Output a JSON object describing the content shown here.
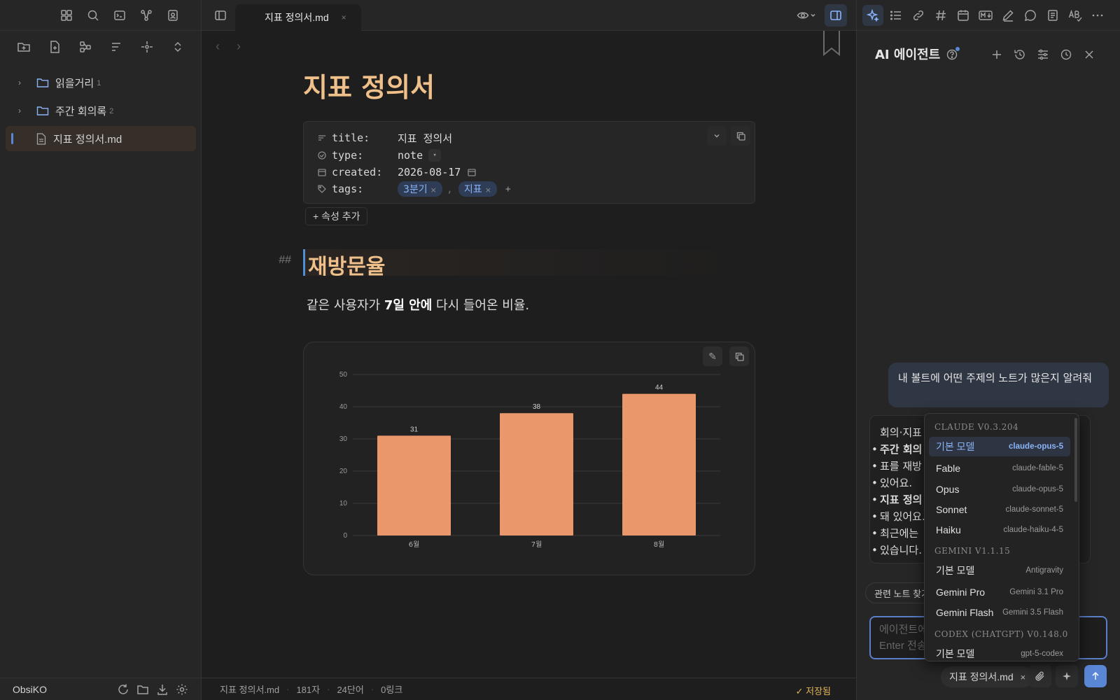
{
  "left_sidebar": {
    "tree": [
      {
        "label": "읽을거리",
        "count": "1",
        "type": "folder"
      },
      {
        "label": "주간 회의록",
        "count": "2",
        "type": "folder"
      },
      {
        "label": "지표 정의서.md",
        "count": "",
        "type": "file",
        "active": true
      }
    ],
    "vault_name": "ObsiKO"
  },
  "tab": {
    "title": "지표 정의서.md",
    "close": "×"
  },
  "note": {
    "title": "지표 정의서",
    "properties": {
      "title_key": "title:",
      "title_val": "지표 정의서",
      "type_key": "type:",
      "type_val": "note",
      "created_key": "created:",
      "created_val": "2026-08-17",
      "tags_key": "tags:",
      "tags": [
        "3분기",
        "지표"
      ]
    },
    "add_property": "+ 속성 추가",
    "heading_marker": "##",
    "heading": "재방문율",
    "para_pre": "같은 사용자가 ",
    "para_bold": "7일 안에",
    "para_post": " 다시 들어온 비율."
  },
  "chart_data": {
    "type": "bar",
    "categories": [
      "6월",
      "7월",
      "8월"
    ],
    "values": [
      31,
      38,
      44
    ],
    "ylim": [
      0,
      50
    ],
    "yticks": [
      0,
      10,
      20,
      30,
      40,
      50
    ],
    "bar_color": "#e9976b",
    "grid": true,
    "title": "",
    "xlabel": "",
    "ylabel": ""
  },
  "status_bar": {
    "file": "지표 정의서.md",
    "chars": "181자",
    "words": "24단어",
    "links": "0링크",
    "saved": "✓ 저장됨"
  },
  "agent": {
    "title": "AI 에이전트",
    "user_message": "내 볼트에 어떤 주제의 노트가 많은지 알려줘",
    "ai_line1": "회의·지표",
    "ai_b1": "주간 회의",
    "ai_b1_rest1": "표를 재방",
    "ai_b1_rest2": "있어요.",
    "ai_b2": "지표 정의",
    "ai_b2_rest1": "돼 있어요.",
    "ai_b2_rest2": "최근에는",
    "ai_b2_rest3": "있습니다.",
    "chip": "관련 노트 찾기",
    "input_placeholder_1": "에이전트에",
    "input_placeholder_2": "Enter 전송",
    "attached_file": "지표 정의서.md",
    "attached_close": "×"
  },
  "model_dropdown": {
    "sections": [
      {
        "title": "CLAUDE  V0.3.204",
        "items": [
          {
            "name": "기본 모델",
            "model": "claude-opus-5",
            "selected": true
          },
          {
            "name": "Fable",
            "model": "claude-fable-5"
          },
          {
            "name": "Opus",
            "model": "claude-opus-5"
          },
          {
            "name": "Sonnet",
            "model": "claude-sonnet-5"
          },
          {
            "name": "Haiku",
            "model": "claude-haiku-4-5"
          }
        ]
      },
      {
        "title": "GEMINI  V1.1.15",
        "items": [
          {
            "name": "기본 모델",
            "model": "Antigravity"
          },
          {
            "name": "Gemini Pro",
            "model": "Gemini 3.1 Pro"
          },
          {
            "name": "Gemini Flash",
            "model": "Gemini 3.5 Flash"
          }
        ]
      },
      {
        "title": "CODEX (CHATGPT)  V0.148.0",
        "items": [
          {
            "name": "기본 모델",
            "model": "gpt-5-codex"
          }
        ]
      }
    ]
  }
}
